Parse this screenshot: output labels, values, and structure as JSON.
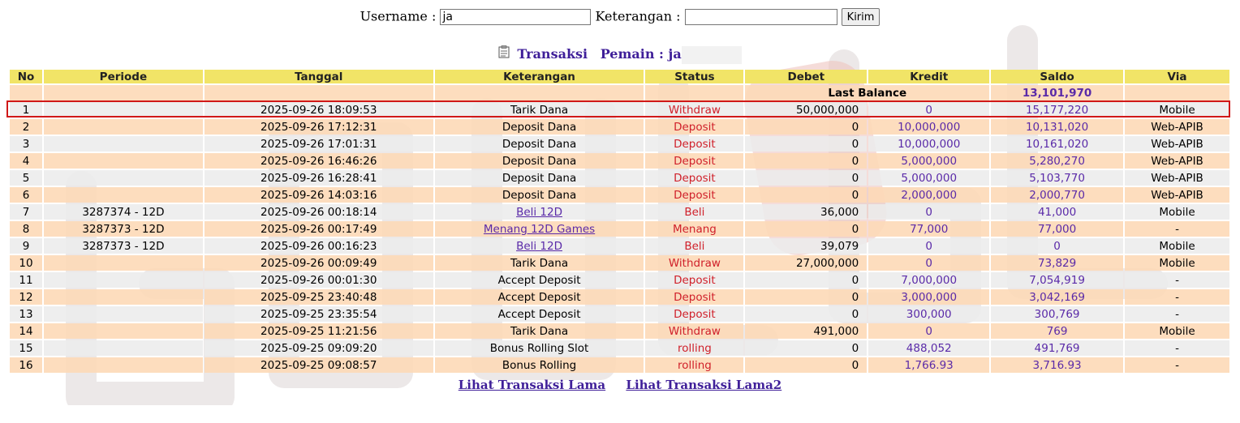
{
  "form": {
    "username_label": "Username :",
    "username_value": "ja",
    "keterangan_label": "Keterangan :",
    "keterangan_value": "",
    "submit_label": "Kirim"
  },
  "heading": {
    "title": "Transaksi",
    "pemain_label": "Pemain : ja"
  },
  "table": {
    "headers": {
      "no": "No",
      "periode": "Periode",
      "tanggal": "Tanggal",
      "keterangan": "Keterangan",
      "status": "Status",
      "debet": "Debet",
      "kredit": "Kredit",
      "saldo": "Saldo",
      "via": "Via"
    },
    "last_balance_label": "Last Balance",
    "last_balance_value": "13,101,970",
    "rows": [
      {
        "no": "1",
        "periode": "",
        "tanggal": "2025-09-26 18:09:53",
        "keterangan": "Tarik Dana",
        "link": false,
        "status": "Withdraw",
        "debet": "50,000,000",
        "kredit": "0",
        "saldo": "15,177,220",
        "via": "Mobile"
      },
      {
        "no": "2",
        "periode": "",
        "tanggal": "2025-09-26 17:12:31",
        "keterangan": "Deposit Dana",
        "link": false,
        "status": "Deposit",
        "debet": "0",
        "kredit": "10,000,000",
        "saldo": "10,131,020",
        "via": "Web-APIB"
      },
      {
        "no": "3",
        "periode": "",
        "tanggal": "2025-09-26 17:01:31",
        "keterangan": "Deposit Dana",
        "link": false,
        "status": "Deposit",
        "debet": "0",
        "kredit": "10,000,000",
        "saldo": "10,161,020",
        "via": "Web-APIB"
      },
      {
        "no": "4",
        "periode": "",
        "tanggal": "2025-09-26 16:46:26",
        "keterangan": "Deposit Dana",
        "link": false,
        "status": "Deposit",
        "debet": "0",
        "kredit": "5,000,000",
        "saldo": "5,280,270",
        "via": "Web-APIB"
      },
      {
        "no": "5",
        "periode": "",
        "tanggal": "2025-09-26 16:28:41",
        "keterangan": "Deposit Dana",
        "link": false,
        "status": "Deposit",
        "debet": "0",
        "kredit": "5,000,000",
        "saldo": "5,103,770",
        "via": "Web-APIB"
      },
      {
        "no": "6",
        "periode": "",
        "tanggal": "2025-09-26 14:03:16",
        "keterangan": "Deposit Dana",
        "link": false,
        "status": "Deposit",
        "debet": "0",
        "kredit": "2,000,000",
        "saldo": "2,000,770",
        "via": "Web-APIB"
      },
      {
        "no": "7",
        "periode": "3287374 - 12D",
        "tanggal": "2025-09-26 00:18:14",
        "keterangan": "Beli 12D",
        "link": true,
        "status": "Beli",
        "debet": "36,000",
        "kredit": "0",
        "saldo": "41,000",
        "via": "Mobile"
      },
      {
        "no": "8",
        "periode": "3287373 - 12D",
        "tanggal": "2025-09-26 00:17:49",
        "keterangan": "Menang 12D Games",
        "link": true,
        "status": "Menang",
        "debet": "0",
        "kredit": "77,000",
        "saldo": "77,000",
        "via": "-"
      },
      {
        "no": "9",
        "periode": "3287373 - 12D",
        "tanggal": "2025-09-26 00:16:23",
        "keterangan": "Beli 12D",
        "link": true,
        "status": "Beli",
        "debet": "39,079",
        "kredit": "0",
        "saldo": "0",
        "via": "Mobile"
      },
      {
        "no": "10",
        "periode": "",
        "tanggal": "2025-09-26 00:09:49",
        "keterangan": "Tarik Dana",
        "link": false,
        "status": "Withdraw",
        "debet": "27,000,000",
        "kredit": "0",
        "saldo": "73,829",
        "via": "Mobile"
      },
      {
        "no": "11",
        "periode": "",
        "tanggal": "2025-09-26 00:01:30",
        "keterangan": "Accept Deposit",
        "link": false,
        "status": "Deposit",
        "debet": "0",
        "kredit": "7,000,000",
        "saldo": "7,054,919",
        "via": "-"
      },
      {
        "no": "12",
        "periode": "",
        "tanggal": "2025-09-25 23:40:48",
        "keterangan": "Accept Deposit",
        "link": false,
        "status": "Deposit",
        "debet": "0",
        "kredit": "3,000,000",
        "saldo": "3,042,169",
        "via": "-"
      },
      {
        "no": "13",
        "periode": "",
        "tanggal": "2025-09-25 23:35:54",
        "keterangan": "Accept Deposit",
        "link": false,
        "status": "Deposit",
        "debet": "0",
        "kredit": "300,000",
        "saldo": "300,769",
        "via": "-"
      },
      {
        "no": "14",
        "periode": "",
        "tanggal": "2025-09-25 11:21:56",
        "keterangan": "Tarik Dana",
        "link": false,
        "status": "Withdraw",
        "debet": "491,000",
        "kredit": "0",
        "saldo": "769",
        "via": "Mobile"
      },
      {
        "no": "15",
        "periode": "",
        "tanggal": "2025-09-25 09:09:20",
        "keterangan": "Bonus Rolling Slot",
        "link": false,
        "status": "rolling",
        "debet": "0",
        "kredit": "488,052",
        "saldo": "491,769",
        "via": "-"
      },
      {
        "no": "16",
        "periode": "",
        "tanggal": "2025-09-25 09:08:57",
        "keterangan": "Bonus Rolling",
        "link": false,
        "status": "rolling",
        "debet": "0",
        "kredit": "1,766.93",
        "saldo": "3,716.93",
        "via": "-"
      }
    ]
  },
  "footer": {
    "link1": "Lihat Transaksi Lama",
    "link2": "Lihat Transaksi Lama2"
  },
  "colors": {
    "header_bg": "#f1e467",
    "row_odd": "#ececec",
    "row_even": "#fdd9b7",
    "status_red": "#d0202a",
    "amount_purple": "#5a2aa8",
    "highlight_border": "#d01818"
  },
  "icons": {
    "heading_icon": "clipboard-icon"
  }
}
